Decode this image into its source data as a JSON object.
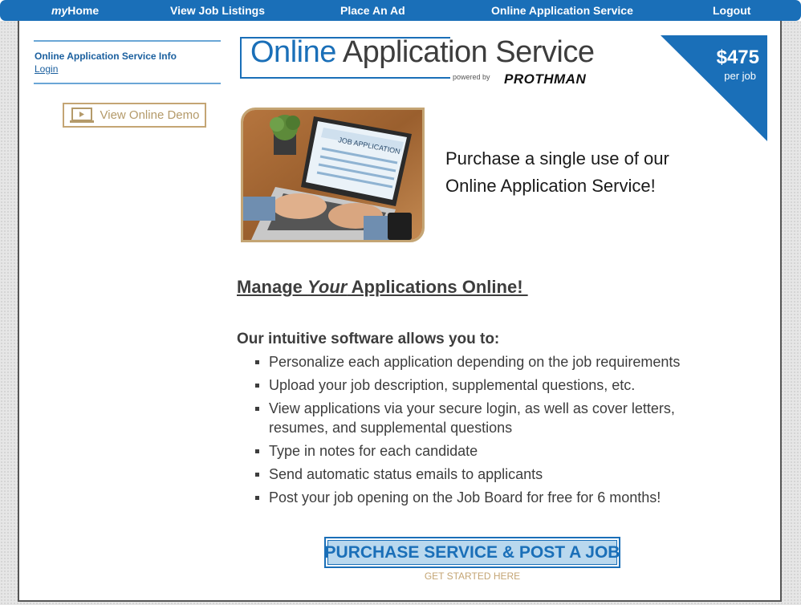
{
  "nav": {
    "my_prefix": "my",
    "home": "Home",
    "job_listings": "View Job Listings",
    "place_ad": "Place An Ad",
    "oas": "Online Application Service",
    "logout": "Logout"
  },
  "sidebar": {
    "info_link": "Online Application Service Info",
    "login_link": "Login",
    "demo_button": "View Online Demo"
  },
  "logo": {
    "word1": "Online",
    "word2": "Application Service",
    "powered_by": "powered by",
    "brand": "PROTHMAN"
  },
  "price": {
    "amount": "$475",
    "unit": "per job"
  },
  "photo": {
    "screen_title": "JOB APPLICATION"
  },
  "tagline": {
    "line1": "Purchase a single use of our",
    "line2": "Online Application Service!"
  },
  "content": {
    "heading_pre": "Manage ",
    "heading_em": "Your",
    "heading_post": " Applications Online! ",
    "intro": "Our intuitive software allows you to:",
    "features": [
      "Personalize each application depending on the job requirements",
      "Upload your job description, supplemental questions, etc.",
      "View applications via your secure login, as well as cover letters, resumes, and supplemental questions",
      "Type in notes for each candidate",
      "Send automatic status emails to applicants",
      "Post your job opening on the Job Board for free for 6 months!"
    ]
  },
  "cta": {
    "label": "PURCHASE SERVICE & POST A JOB",
    "sub": "GET STARTED HERE"
  },
  "colors": {
    "brand_blue": "#1a6fb8",
    "gold": "#c4a574",
    "cta_fill": "#b9d8ee"
  }
}
